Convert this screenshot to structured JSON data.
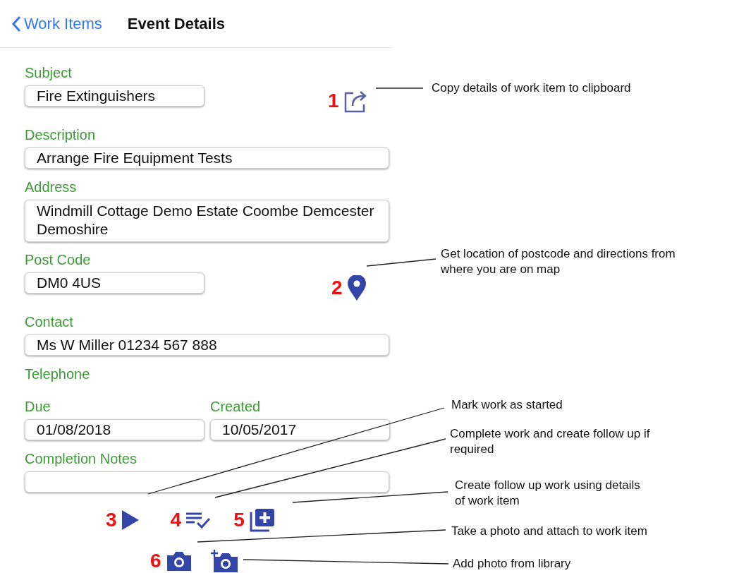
{
  "nav": {
    "back_label": "Work Items",
    "title": "Event Details"
  },
  "subject": {
    "label": "Subject",
    "value": "Fire Extinguishers"
  },
  "description": {
    "label": "Description",
    "value": "Arrange Fire Equipment Tests"
  },
  "address": {
    "label": "Address",
    "value": "Windmill Cottage Demo Estate Coombe Demcester Demoshire"
  },
  "post_code": {
    "label": "Post Code",
    "value": "DM0 4US"
  },
  "contact": {
    "label": "Contact",
    "value": "Ms W Miller 01234 567 888"
  },
  "telephone": {
    "label": "Telephone"
  },
  "due": {
    "label": "Due",
    "value": "01/08/2018"
  },
  "created": {
    "label": "Created",
    "value": "10/05/2017"
  },
  "completion_notes": {
    "label": "Completion Notes"
  },
  "markers": [
    "1",
    "2",
    "3",
    "4",
    "5",
    "6"
  ],
  "notes": [
    {
      "lines": [
        "Copy details of work item to clipboard"
      ]
    },
    {
      "lines": [
        "Get location of postcode and directions from",
        "where you are on map"
      ]
    },
    {
      "lines": [
        "Mark work as started"
      ]
    },
    {
      "lines": [
        "Complete work and create follow up if",
        "required"
      ]
    },
    {
      "lines": [
        "Create follow up work using details",
        "of work item"
      ]
    },
    {
      "lines": [
        "Take a photo and attach to work item"
      ]
    },
    {
      "lines": [
        "Add photo from library"
      ]
    }
  ]
}
